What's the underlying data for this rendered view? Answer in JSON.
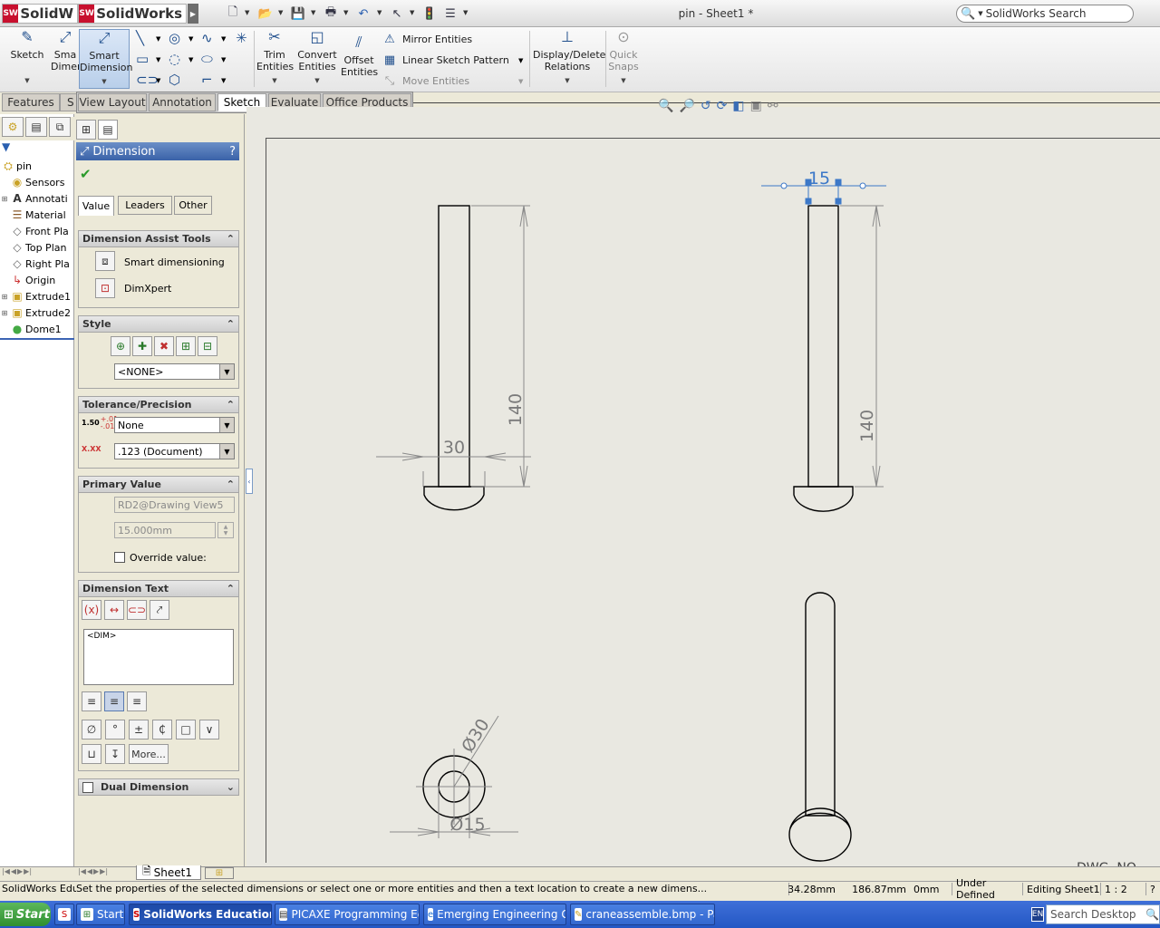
{
  "app": {
    "logo_text_1": "SolidW",
    "logo_text_2": "SolidWorks",
    "badge": "SW",
    "document_title": "pin - Sheet1 *",
    "search_placeholder": "SolidWorks Search"
  },
  "ribbon": {
    "sketch": "Sketch",
    "smart_dim_partial_1": "Sma",
    "smart_dim_partial_2": "Dimen",
    "smart_dimension_1": "Smart",
    "smart_dimension_2": "Dimension",
    "trim_1": "Trim",
    "trim_2": "Entities",
    "convert_1": "Convert",
    "convert_2": "Entities",
    "offset_1": "Offset",
    "offset_2": "Entities",
    "mirror": "Mirror Entities",
    "linear_pattern": "Linear Sketch Pattern",
    "move": "Move Entities",
    "display_delete_1": "Display/Delete",
    "display_delete_2": "Relations",
    "quick_snaps_1": "Quick",
    "quick_snaps_2": "Snaps"
  },
  "tabs": [
    "Features",
    "S",
    "View Layout",
    "Annotation",
    "Sketch",
    "Evaluate",
    "Office Products"
  ],
  "tree": {
    "root": "pin",
    "items": [
      "Sensors",
      "Annotati",
      "Material",
      "Front Pla",
      "Top Plan",
      "Right Pla",
      "Origin",
      "Extrude1",
      "Extrude2",
      "Dome1"
    ]
  },
  "pm": {
    "title": "Dimension",
    "help": "?",
    "subtabs": [
      "Value",
      "Leaders",
      "Other"
    ],
    "assist": {
      "title": "Dimension Assist Tools",
      "smart": "Smart dimensioning",
      "dimxpert": "DimXpert"
    },
    "style": {
      "title": "Style",
      "value": "<NONE>"
    },
    "tolerance": {
      "title": "Tolerance/Precision",
      "type": "None",
      "precision": ".123 (Document)",
      "tol_icon_text": "1.50",
      "tol_plus": "+.01",
      "tol_minus": "-.01",
      "prec_icon_text": "X.XX"
    },
    "primary": {
      "title": "Primary Value",
      "name": "RD2@Drawing View5",
      "value": "15.000mm",
      "override": "Override value:"
    },
    "dimtext": {
      "title": "Dimension Text",
      "text": "<DIM>",
      "more": "More..."
    },
    "dual": "Dual Dimension"
  },
  "drawing": {
    "dim_140_left": "140",
    "dim_30_left": "30",
    "dim_15_top": "15",
    "dim_140_right": "140",
    "dim_dia30": "Ø30",
    "dim_dia15": "Ø15",
    "title_block_fragment": "DWG. NO."
  },
  "sheet_tab": "Sheet1",
  "status": {
    "left": "SolidWorks Educ",
    "message": "Set the properties of the selected dimensions or select one or more entities and then a text location to create a new dimens...",
    "x": "34.28mm",
    "y": "186.87mm",
    "z": "0mm",
    "state": "Under Defined",
    "editing": "Editing Sheet1",
    "scale": "1 : 2"
  },
  "taskbar": {
    "start": "Start",
    "buttons": [
      "Start",
      "SolidWorks Education...",
      "PICAXE Programming Edi...",
      "Emerging Engineering Gr...",
      "craneassemble.bmp - Paint"
    ],
    "lang": "EN",
    "search": "Search Desktop"
  }
}
